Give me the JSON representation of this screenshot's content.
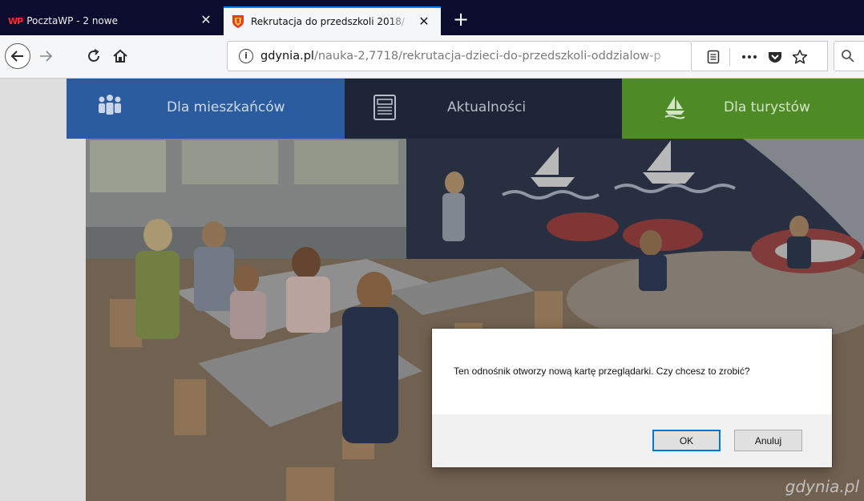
{
  "browser": {
    "tabs": [
      {
        "favicon": "WP",
        "title": "PocztaWP - 2 nowe",
        "active": false
      },
      {
        "favicon": "gdynia-shield-icon",
        "title": "Rekrutacja do przedszkoli 2018/",
        "active": true
      }
    ],
    "new_tab_label": "+",
    "url": {
      "domain": "gdynia.pl",
      "path": "/nauka-2,7718/rekrutacja-dzieci-do-przedszkoli-oddzialow-p"
    }
  },
  "site_nav": [
    {
      "label": "Dla mieszkańców",
      "icon": "people-icon",
      "color": "#2b5c9f"
    },
    {
      "label": "Aktualności",
      "icon": "newspaper-icon",
      "color": "#1d2537"
    },
    {
      "label": "Dla turystów",
      "icon": "sailboat-icon",
      "color": "#4e8b26"
    }
  ],
  "watermark": "gdynia.pl",
  "dialog": {
    "message": "Ten odnośnik otworzy nową kartę przeglądarki. Czy chcesz to zrobić?",
    "ok_label": "OK",
    "cancel_label": "Anuluj"
  }
}
